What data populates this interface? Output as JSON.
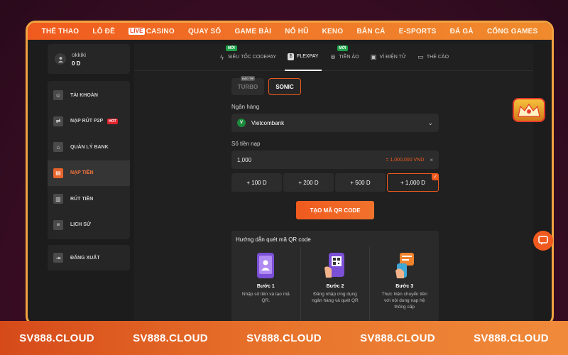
{
  "topnav": [
    "THỂ THAO",
    "LÔ ĐỀ",
    "CASINO",
    "QUAY SỐ",
    "GAME BÀI",
    "NỔ HŨ",
    "KENO",
    "BẮN CÁ",
    "E-SPORTS",
    "ĐÁ GÀ",
    "CỔNG GAMES"
  ],
  "live_badge": "LIVE",
  "user": {
    "name": "okkiki",
    "balance": "0 D"
  },
  "sidebar": {
    "items": [
      {
        "label": "TÀI KHOẢN",
        "icon": "person-icon"
      },
      {
        "label": "NẠP RÚT P2P",
        "icon": "p2p-icon",
        "badge": "HOT"
      },
      {
        "label": "QUẢN LÝ BANK",
        "icon": "bank-icon"
      },
      {
        "label": "NẠP TIỀN",
        "icon": "deposit-icon"
      },
      {
        "label": "RÚT TIỀN",
        "icon": "withdraw-icon"
      },
      {
        "label": "LỊCH SỬ",
        "icon": "history-icon"
      }
    ],
    "logout": "ĐĂNG XUẤT"
  },
  "tabs": [
    {
      "label": "SIÊU TỐC CODEPAY",
      "badge": "MỚI"
    },
    {
      "label": "FLEXPAY",
      "badge": ""
    },
    {
      "label": "TIỀN ẢO",
      "badge": "MỚI"
    },
    {
      "label": "VÍ ĐIỆN TỬ",
      "badge": ""
    },
    {
      "label": "THẺ CÀO",
      "badge": ""
    }
  ],
  "subtabs": [
    {
      "label": "TURBO",
      "badge": "BẢO TRÌ"
    },
    {
      "label": "SONIC",
      "badge": ""
    }
  ],
  "bank": {
    "label": "Ngân hàng",
    "value": "Vietcombank",
    "logo_text": "V"
  },
  "amount": {
    "label": "Số tiền nạp",
    "value": "1,000",
    "converted": "= 1,000,000 VND",
    "clear": "×"
  },
  "quick_amounts": [
    "+ 100 D",
    "+ 200 D",
    "+ 500 D",
    "+ 1,000 D"
  ],
  "qr_button": "TẠO MÃ QR CODE",
  "guide": {
    "title": "Hướng dẫn quét mã QR code",
    "steps": [
      {
        "title": "Bước 1",
        "desc": "Nhập số tiền và tạo mã QR."
      },
      {
        "title": "Bước 2",
        "desc": "Đăng nhập ứng dụng ngân hàng và quét QR"
      },
      {
        "title": "Bước 3",
        "desc": "Thực hiện chuyển tiền với nội dung nạp hệ thống cấp"
      }
    ]
  },
  "brand": [
    "SV888.CLOUD",
    "SV888.CLOUD",
    "SV888.CLOUD",
    "SV888.CLOUD",
    "SV888.CLOUD"
  ],
  "colors": {
    "accent": "#f05a1e",
    "panel": "#262626",
    "background": "#1c1c1c"
  }
}
